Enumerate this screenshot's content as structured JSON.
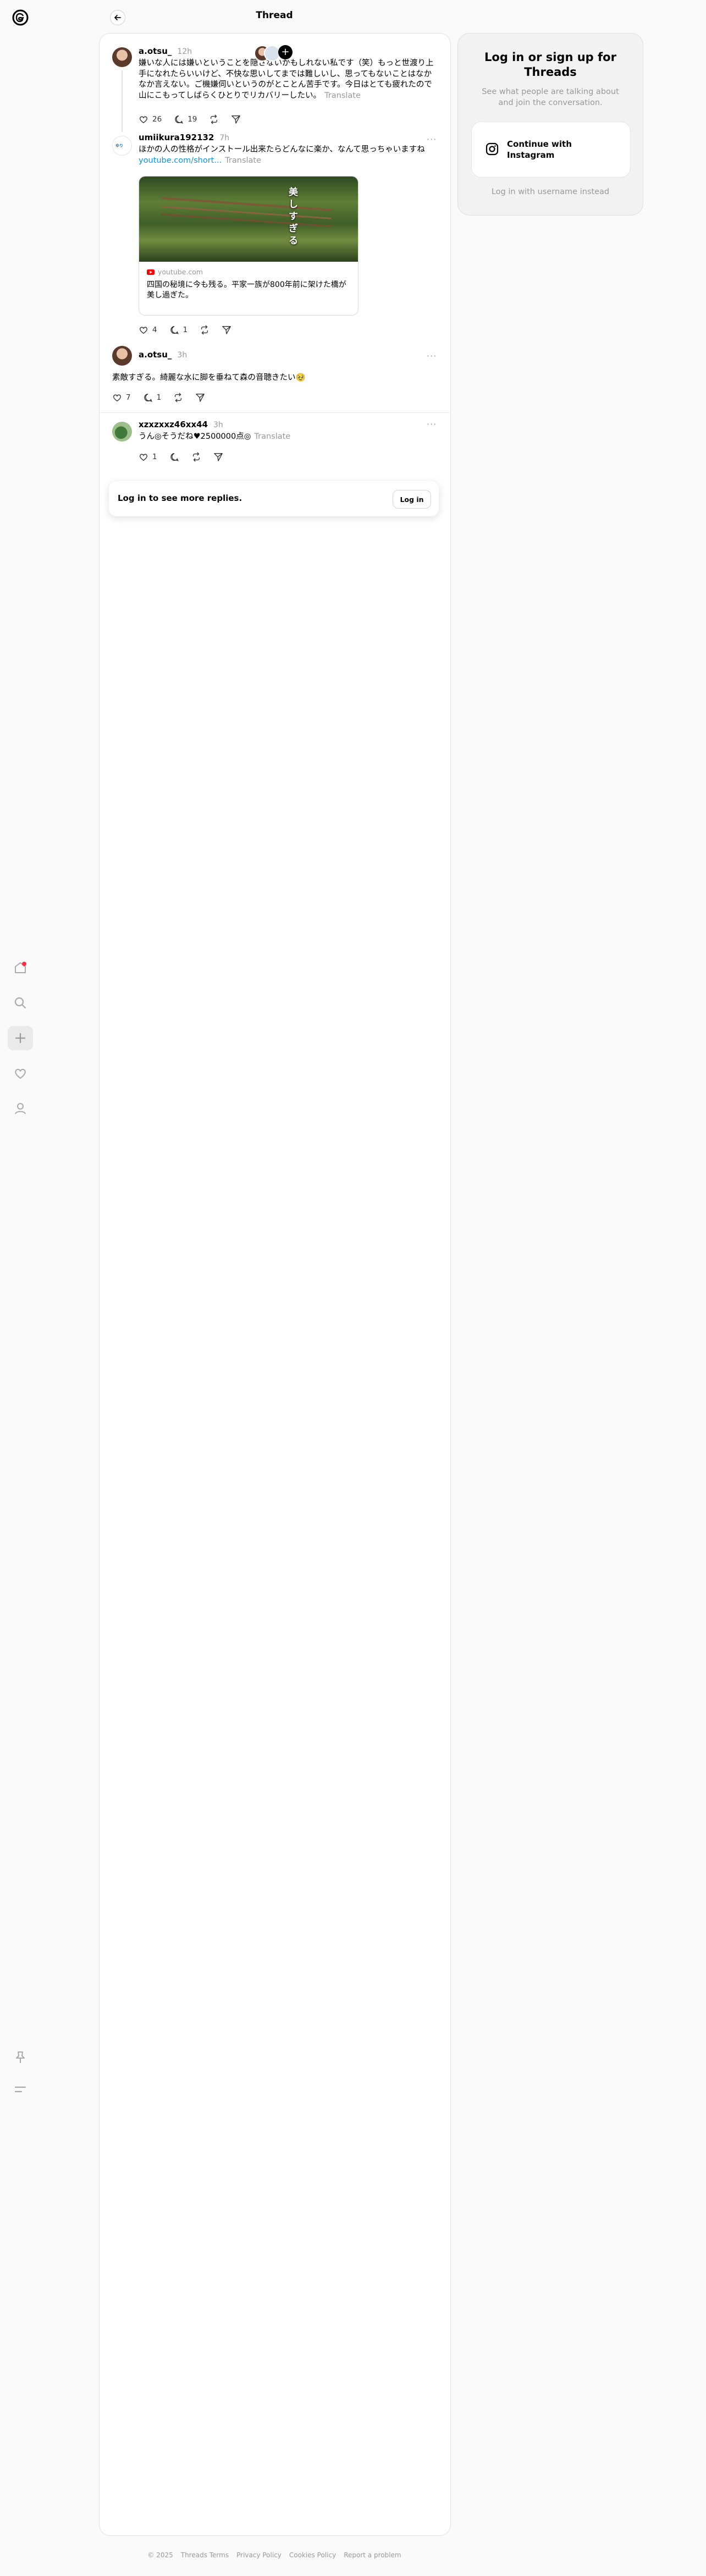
{
  "header": {
    "title": "Thread"
  },
  "posts": [
    {
      "username": "a.otsu_",
      "time": "12h",
      "text": "嫌いな人には嫌いということを隠さないかもしれない私です（笑）もっと世渡り上手になれたらいいけど、不快な思いしてまでは難しいし、思ってもないことはなかなか言えない。ご機嫌伺いというのがとことん苦手です。今日はとても疲れたので山にこもってしばらくひとりでリカバリーしたい。",
      "translate": "Translate",
      "likes": "26",
      "replies": "19"
    },
    {
      "username": "umiikura192132",
      "time": "7h",
      "text": "ほかの人の性格がインストール出来たらどんなに楽か、なんて思っちゃいますね",
      "link": "youtube.com/short...",
      "translate": "Translate",
      "preview": {
        "domain": "youtube.com",
        "title": "四国の秘境に今も残る。平家一族が800年前に架けた橋が美し過ぎた。",
        "thumb_text": "美しすぎる"
      },
      "likes": "4",
      "replies": "1"
    },
    {
      "username": "a.otsu_",
      "time": "3h",
      "text": "素敵すぎる。綺麗な水に脚を垂ねて森の音聴きたい🥹",
      "likes": "7",
      "replies": "1"
    },
    {
      "username": "xzxzxxz46xx44",
      "time": "3h",
      "text": "うん◎そうだね♥2500000点◎",
      "translate": "Translate",
      "likes": "1"
    }
  ],
  "login_bar": {
    "text": "Log in to see more replies.",
    "button": "Log in"
  },
  "right_panel": {
    "title": "Log in or sign up for Threads",
    "subtitle": "See what people are talking about and join the conversation.",
    "ig_button": "Continue with Instagram",
    "username_login": "Log in with username instead"
  },
  "footer": [
    "© 2025",
    "Threads Terms",
    "Privacy Policy",
    "Cookies Policy",
    "Report a problem"
  ],
  "icons": {
    "sidebar": [
      "threads-logo-icon",
      "home-icon",
      "search-icon",
      "create-icon",
      "activity-heart-icon",
      "profile-icon",
      "pin-icon",
      "menu-icon"
    ],
    "actions": [
      "heart-icon",
      "comment-icon",
      "repost-icon",
      "share-icon"
    ]
  },
  "colors": {
    "link": "#0095f6",
    "muted": "#999999",
    "notification_dot": "#ff3040",
    "youtube_red": "#ff0000"
  }
}
